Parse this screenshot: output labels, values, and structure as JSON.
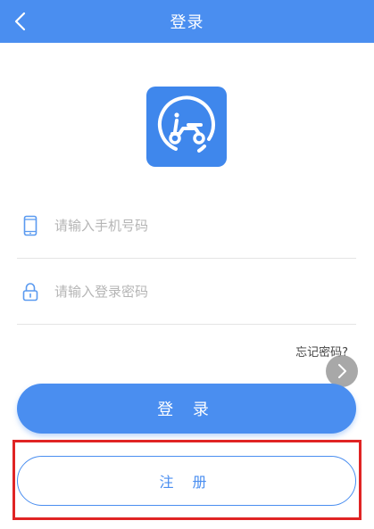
{
  "header": {
    "title": "登录",
    "background": "#4a8ef0"
  },
  "logo": {
    "icon": "scooter-icon"
  },
  "form": {
    "phone": {
      "placeholder": "请输入手机号码",
      "value": "",
      "icon": "phone-icon"
    },
    "password": {
      "placeholder": "请输入登录密码",
      "value": "",
      "icon": "lock-icon"
    },
    "forgot_label": "忘记密码?"
  },
  "buttons": {
    "login_label": "登 录",
    "register_label": "注 册"
  },
  "colors": {
    "accent": "#4a8ef0",
    "highlight": "#e02424"
  }
}
